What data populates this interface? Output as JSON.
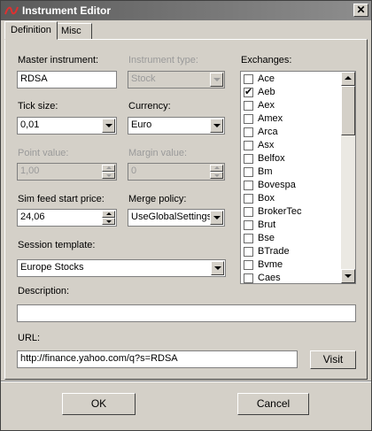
{
  "window": {
    "title": "Instrument Editor"
  },
  "tabs": [
    {
      "label": "Definition",
      "active": true
    },
    {
      "label": "Misc",
      "active": false
    }
  ],
  "form": {
    "master_instrument": {
      "label": "Master instrument:",
      "value": "RDSA"
    },
    "instrument_type": {
      "label": "Instrument type:",
      "value": "Stock",
      "disabled": true
    },
    "tick_size": {
      "label": "Tick size:",
      "value": "0,01"
    },
    "currency": {
      "label": "Currency:",
      "value": "Euro"
    },
    "point_value": {
      "label": "Point value:",
      "value": "1,00",
      "disabled": true
    },
    "margin_value": {
      "label": "Margin value:",
      "value": "0",
      "disabled": true
    },
    "sim_feed_start_price": {
      "label": "Sim feed start price:",
      "value": "24,06"
    },
    "merge_policy": {
      "label": "Merge policy:",
      "value": "UseGlobalSettings"
    },
    "session_template": {
      "label": "Session template:",
      "value": "Europe Stocks"
    },
    "description": {
      "label": "Description:",
      "value": ""
    },
    "url": {
      "label": "URL:",
      "value": "http://finance.yahoo.com/q?s=RDSA"
    },
    "visit_label": "Visit"
  },
  "exchanges": {
    "label": "Exchanges:",
    "items": [
      {
        "name": "Ace",
        "checked": false
      },
      {
        "name": "Aeb",
        "checked": true
      },
      {
        "name": "Aex",
        "checked": false
      },
      {
        "name": "Amex",
        "checked": false
      },
      {
        "name": "Arca",
        "checked": false
      },
      {
        "name": "Asx",
        "checked": false
      },
      {
        "name": "Belfox",
        "checked": false
      },
      {
        "name": "Bm",
        "checked": false
      },
      {
        "name": "Bovespa",
        "checked": false
      },
      {
        "name": "Box",
        "checked": false
      },
      {
        "name": "BrokerTec",
        "checked": false
      },
      {
        "name": "Brut",
        "checked": false
      },
      {
        "name": "Bse",
        "checked": false
      },
      {
        "name": "BTrade",
        "checked": false
      },
      {
        "name": "Bvme",
        "checked": false
      },
      {
        "name": "Caes",
        "checked": false
      }
    ]
  },
  "buttons": {
    "ok": "OK",
    "cancel": "Cancel"
  },
  "icons": {
    "app": "ninja-logo-icon",
    "close": "close-icon",
    "check": "✔",
    "close_glyph": "✕"
  },
  "colors": {
    "title_start": "#5a5a5a",
    "title_end": "#8e8e8e",
    "face": "#d4d0c8"
  }
}
